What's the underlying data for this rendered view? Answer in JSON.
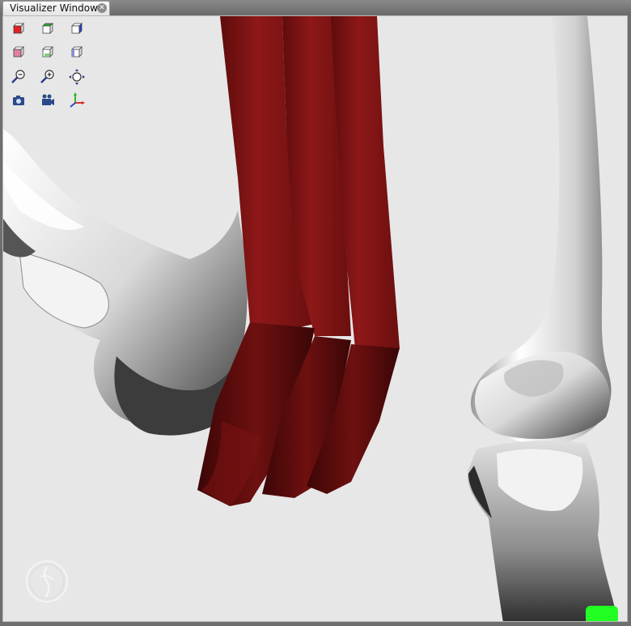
{
  "window": {
    "tab_title": "Visualizer Window",
    "close_glyph": "✕"
  },
  "toolbar": {
    "buttons": [
      {
        "name": "view-front-button",
        "icon": "cube-red-face-icon",
        "color": "#e02020"
      },
      {
        "name": "view-top-button",
        "icon": "cube-green-face-icon",
        "color": "#20b020"
      },
      {
        "name": "view-right-button",
        "icon": "cube-blue-face-icon",
        "color": "#2040d0"
      },
      {
        "name": "view-back-button",
        "icon": "cube-pink-face-icon",
        "color": "#e080a0"
      },
      {
        "name": "view-bottom-button",
        "icon": "cube-lightgreen-face-icon",
        "color": "#80d080"
      },
      {
        "name": "view-left-button",
        "icon": "cube-lightblue-face-icon",
        "color": "#8090e0"
      },
      {
        "name": "zoom-out-button",
        "icon": "zoom-out-icon"
      },
      {
        "name": "zoom-in-button",
        "icon": "zoom-in-icon"
      },
      {
        "name": "fit-view-button",
        "icon": "fit-to-view-icon"
      },
      {
        "name": "snapshot-button",
        "icon": "camera-icon"
      },
      {
        "name": "record-movie-button",
        "icon": "movie-camera-icon"
      },
      {
        "name": "axes-toggle-button",
        "icon": "axes-icon"
      }
    ]
  },
  "scene": {
    "background": "#e7e7e7",
    "muscle_color": "#7a1212",
    "bone_color": "#e8e8e8",
    "marker_color": "#22ff22"
  }
}
